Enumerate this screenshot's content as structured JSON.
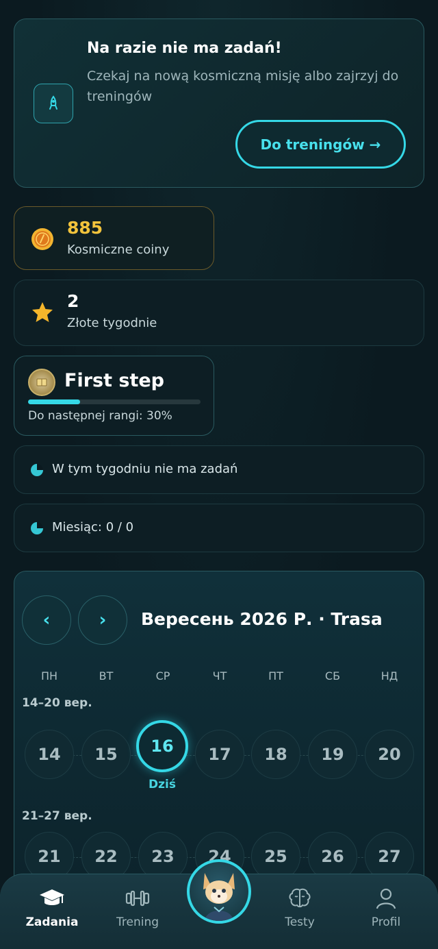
{
  "hero": {
    "title": "Na razie nie ma zadań!",
    "subtitle": "Czekaj na nową kosmiczną misję albo zajrzyj do treningów",
    "button": "Do treningów →",
    "icon": "rocket-icon"
  },
  "stats": {
    "coins": {
      "value": "885",
      "label": "Kosmiczne coiny",
      "icon": "coin-icon"
    },
    "gold_weeks": {
      "value": "2",
      "label": "Złote tygodnie",
      "icon": "star-icon"
    }
  },
  "rank": {
    "name": "First step",
    "next_label": "Do następnej rangi: 30%",
    "progress": 0.3
  },
  "week_info": "W tym tygodniu nie ma zadań",
  "month_info": "Miesiąc: 0 / 0",
  "calendar": {
    "prev": "‹",
    "next": "›",
    "title": "Вересень 2026 Р. · Trasa",
    "weekdays": [
      "ПН",
      "ВТ",
      "СР",
      "ЧТ",
      "ПТ",
      "СБ",
      "НД"
    ],
    "weeks": [
      {
        "range": "14–20 вер.",
        "days": [
          "14",
          "15",
          "16",
          "17",
          "18",
          "19",
          "20"
        ]
      },
      {
        "range": "21–27 вер.",
        "days": [
          "21",
          "22",
          "23",
          "24",
          "25",
          "26",
          "27"
        ]
      }
    ],
    "today_label": "Dziś",
    "accent": "#35d8e6"
  },
  "tabs": [
    {
      "label": "Zadania",
      "icon": "graduation-cap-icon"
    },
    {
      "label": "Trening",
      "icon": "dumbbell-icon"
    },
    {
      "label": "Testy",
      "icon": "brain-icon"
    },
    {
      "label": "Profil",
      "icon": "user-icon"
    }
  ]
}
